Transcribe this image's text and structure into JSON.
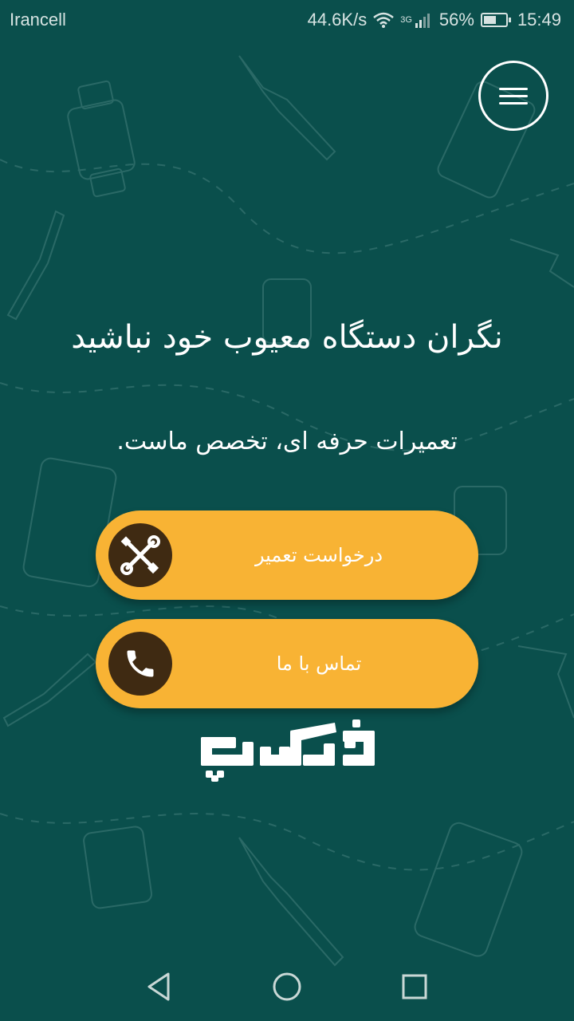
{
  "status_bar": {
    "carrier": "Irancell",
    "network_speed": "44.6K/s",
    "network_type": "3G",
    "battery_percent": "56%",
    "battery_level": 0.56,
    "time": "15:49",
    "icons": [
      "wifi-icon",
      "signal-icon",
      "battery-icon"
    ]
  },
  "header": {
    "menu_icon": "hamburger-menu-icon"
  },
  "hero": {
    "headline": "نگران دستگاه معیوب خود نباشید",
    "subline": "تعمیرات حرفه ای، تخصص ماست."
  },
  "actions": {
    "repair_request": {
      "label": "درخواست تعمیر",
      "icon": "tools-icon"
    },
    "contact_us": {
      "label": "تماس با ما",
      "icon": "phone-icon"
    }
  },
  "logo": {
    "text": "فیکسچی"
  },
  "nav": {
    "back_icon": "back-triangle-icon",
    "home_icon": "home-circle-icon",
    "recents_icon": "recents-square-icon"
  },
  "colors": {
    "background": "#0a4f4c",
    "button": "#f8b334",
    "icon_circle": "#3f2a12",
    "text": "#ffffff"
  }
}
